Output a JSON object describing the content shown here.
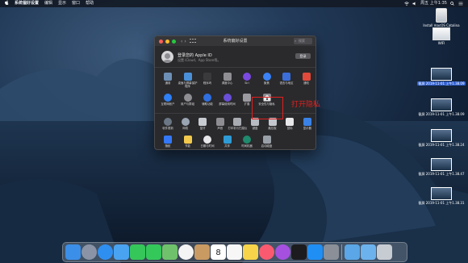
{
  "menubar": {
    "app_name": "系统偏好设置",
    "menus": [
      "编辑",
      "显示",
      "窗口",
      "帮助"
    ],
    "clock": "周五 上午1:35"
  },
  "desktop": [
    {
      "label": "Install macOS Catalina",
      "type": "drive",
      "selected": false
    },
    {
      "label": "WIFI",
      "type": "file",
      "selected": false
    },
    {
      "label": "截屏 2019-11-01 上午1.38.09",
      "type": "shot",
      "selected": true
    },
    {
      "label": "截屏 2019-11-01 上午1.38.09",
      "type": "shot",
      "selected": false
    },
    {
      "label": "截屏 2019-11-01 上午1.38.24",
      "type": "shot",
      "selected": false
    },
    {
      "label": "截屏 2019-11-01 上午1.38.47",
      "type": "shot",
      "selected": false
    },
    {
      "label": "截屏 2019-11-01 上午1.38.31",
      "type": "shot",
      "selected": false
    }
  ],
  "window": {
    "title": "系统偏好设置",
    "search_placeholder": "搜索",
    "account": {
      "title": "登录您的 Apple ID",
      "subtitle": "设置 iCloud、App Store等。",
      "button": "登录"
    },
    "row1": [
      {
        "label": "通用",
        "icon": "general-icon",
        "color": "#6d8fb5"
      },
      {
        "label": "桌面与屏幕保护程序",
        "icon": "desktop-icon",
        "color": "#4a90d9"
      },
      {
        "label": "程序坞",
        "icon": "dock-icon",
        "color": "#3a3a3c"
      },
      {
        "label": "调度中心",
        "icon": "mission-control-icon",
        "color": "#8e8e93"
      },
      {
        "label": "Siri",
        "icon": "siri-icon",
        "color": "#7b4ae0"
      },
      {
        "label": "聚焦",
        "icon": "spotlight-icon",
        "color": "#3b82f6"
      },
      {
        "label": "语言与地区",
        "icon": "language-icon",
        "color": "#3b6ed8"
      },
      {
        "label": "通知",
        "icon": "notifications-icon",
        "color": "#e24a3b"
      }
    ],
    "row2": [
      {
        "label": "互联网帐户",
        "icon": "internet-accounts-icon",
        "color": "#2f7ff5"
      },
      {
        "label": "用户与群组",
        "icon": "users-icon",
        "color": "#8e8e93"
      },
      {
        "label": "辅助功能",
        "icon": "accessibility-icon",
        "color": "#2f6fe0"
      },
      {
        "label": "屏幕使用时间",
        "icon": "screen-time-icon",
        "color": "#6a4fd8"
      },
      {
        "label": "扩展",
        "icon": "extensions-icon",
        "color": "#9a9aa0"
      },
      {
        "label": "安全性与隐私",
        "icon": "security-icon",
        "color": "#8a8a90"
      }
    ],
    "row3": [
      {
        "label": "软件更新",
        "icon": "software-update-icon",
        "color": "#6b7785"
      },
      {
        "label": "网络",
        "icon": "network-icon",
        "color": "#9aa5b4"
      },
      {
        "label": "蓝牙",
        "icon": "bluetooth-icon",
        "color": "#c8ccd2"
      },
      {
        "label": "声音",
        "icon": "sound-icon",
        "color": "#8e8e93"
      },
      {
        "label": "打印机与扫描仪",
        "icon": "printers-icon",
        "color": "#a8acb2"
      },
      {
        "label": "键盘",
        "icon": "keyboard-icon",
        "color": "#b8bcc2"
      },
      {
        "label": "触控板",
        "icon": "trackpad-icon",
        "color": "#c4c8ce"
      },
      {
        "label": "鼠标",
        "icon": "mouse-icon",
        "color": "#e8e8ea"
      },
      {
        "label": "显示器",
        "icon": "displays-icon",
        "color": "#3a82e6"
      }
    ],
    "row4": [
      {
        "label": "随航",
        "icon": "sidecar-icon",
        "color": "#3478f6"
      },
      {
        "label": "节能",
        "icon": "energy-saver-icon",
        "color": "#f2c94c"
      },
      {
        "label": "日期与时间",
        "icon": "date-time-icon",
        "color": "#e8e8ea"
      },
      {
        "label": "共享",
        "icon": "sharing-icon",
        "color": "#2f9bd6"
      },
      {
        "label": "时间机器",
        "icon": "time-machine-icon",
        "color": "#1f8a6e"
      },
      {
        "label": "启动磁盘",
        "icon": "startup-disk-icon",
        "color": "#9aa0a8"
      }
    ]
  },
  "annotation": "打开隐私",
  "dock": [
    {
      "name": "finder-icon",
      "color": "#3b8fe8"
    },
    {
      "name": "launchpad-icon",
      "color": "#8a94a6"
    },
    {
      "name": "safari-icon",
      "color": "#2f8ff0"
    },
    {
      "name": "mail-icon",
      "color": "#4aa3f0"
    },
    {
      "name": "facetime-icon",
      "color": "#35c759"
    },
    {
      "name": "messages-icon",
      "color": "#34c85a"
    },
    {
      "name": "maps-icon",
      "color": "#6fc26b"
    },
    {
      "name": "photos-icon",
      "color": "#f4f4f4"
    },
    {
      "name": "contacts-icon",
      "color": "#c99a62"
    },
    {
      "name": "calendar-icon",
      "color": "#ffffff"
    },
    {
      "name": "reminders-icon",
      "color": "#f7f7f7"
    },
    {
      "name": "notes-icon",
      "color": "#f7d44a"
    },
    {
      "name": "music-icon",
      "color": "#fa5a6f"
    },
    {
      "name": "podcasts-icon",
      "color": "#a650e0"
    },
    {
      "name": "tv-icon",
      "color": "#1c1c1e"
    },
    {
      "name": "app-store-icon",
      "color": "#1f8ff5"
    },
    {
      "name": "system-preferences-icon",
      "color": "#8a8f98"
    },
    {
      "name": "downloads-folder-icon",
      "color": "#5aa6e6"
    },
    {
      "name": "documents-folder-icon",
      "color": "#6cb3ee"
    },
    {
      "name": "trash-icon",
      "color": "#c7ccd3"
    }
  ],
  "calendar_day": "8"
}
